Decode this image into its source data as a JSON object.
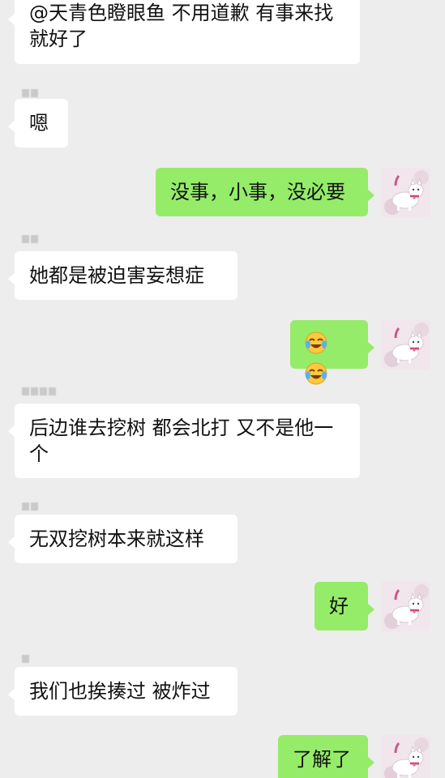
{
  "messages": [
    {
      "side": "in",
      "text": "@天青色瞪眼鱼 不用道歉 有事来找就好了"
    },
    {
      "side": "in",
      "text": "嗯"
    },
    {
      "side": "out",
      "text": "没事，小事，没必要"
    },
    {
      "side": "in",
      "text": "她都是被迫害妄想症"
    },
    {
      "side": "out",
      "emoji_1": "laughing-crying-emoji",
      "emoji_2": "laughing-crying-emoji"
    },
    {
      "side": "in",
      "text": "后边谁去挖树 都会北打 又不是他一个"
    },
    {
      "side": "in",
      "text": "无双挖树本来就这样"
    },
    {
      "side": "out",
      "text": "好"
    },
    {
      "side": "in",
      "text": "我们也挨揍过 被炸过"
    },
    {
      "side": "out",
      "text": "了解了"
    }
  ],
  "colors": {
    "background": "#EDEDED",
    "incoming_bubble": "#FFFFFF",
    "outgoing_bubble": "#95EC69"
  },
  "avatar": {
    "icon": "white-cat-avatar"
  }
}
